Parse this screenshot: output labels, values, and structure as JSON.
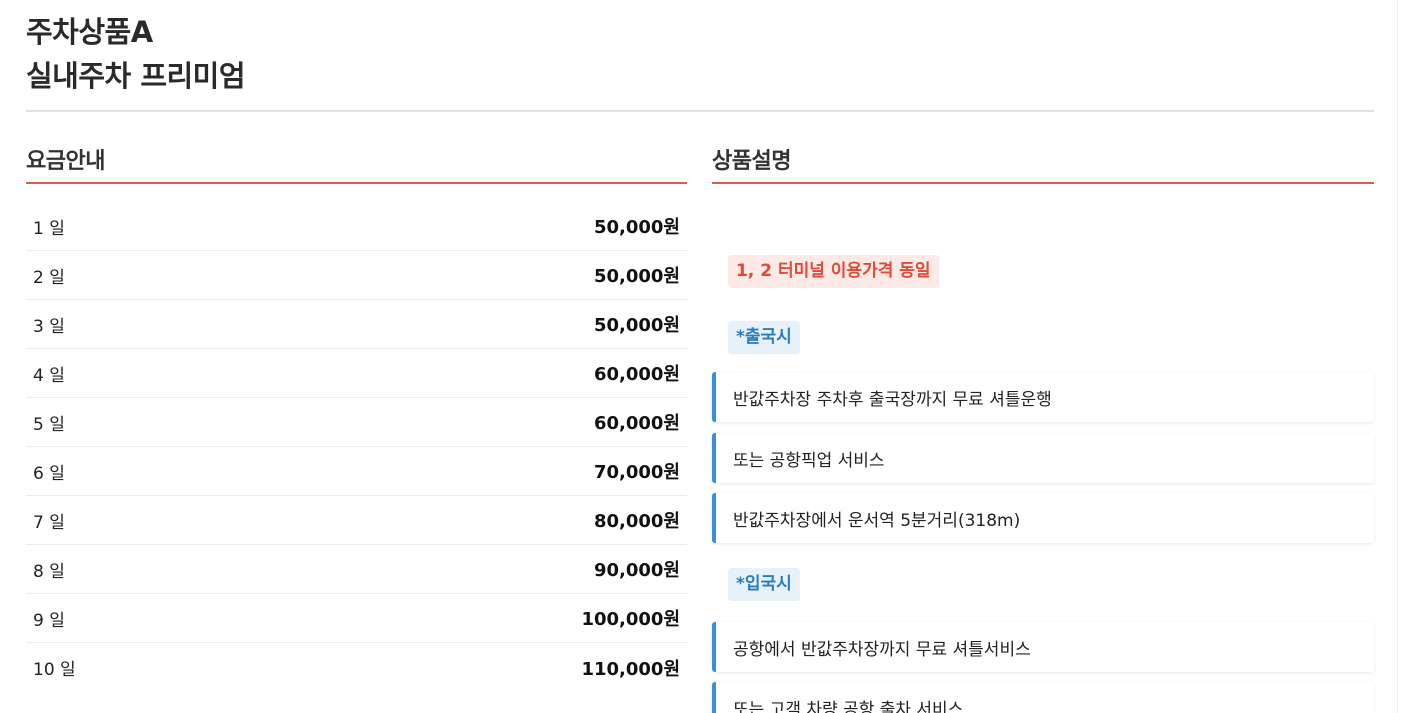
{
  "header": {
    "line1": "주차상품A",
    "line2": "실내주차 프리미엄"
  },
  "pricing": {
    "title": "요금안내",
    "rows": [
      {
        "day": "1 일",
        "price": "50,000원"
      },
      {
        "day": "2 일",
        "price": "50,000원"
      },
      {
        "day": "3 일",
        "price": "50,000원"
      },
      {
        "day": "4 일",
        "price": "60,000원"
      },
      {
        "day": "5 일",
        "price": "60,000원"
      },
      {
        "day": "6 일",
        "price": "70,000원"
      },
      {
        "day": "7 일",
        "price": "80,000원"
      },
      {
        "day": "8 일",
        "price": "90,000원"
      },
      {
        "day": "9 일",
        "price": "100,000원"
      },
      {
        "day": "10 일",
        "price": "110,000원"
      }
    ]
  },
  "description": {
    "title": "상품설명",
    "notice": "1, 2 터미널 이용가격 동일",
    "departure": {
      "label": "*출국시",
      "items": [
        "반값주차장 주차후 출국장까지 무료 셔틀운행",
        "또는 공항픽업 서비스",
        "반값주차장에서 운서역 5분거리(318m)"
      ]
    },
    "arrival": {
      "label": "*입국시",
      "items": [
        "공항에서 반값주차장까지 무료 셔틀서비스",
        "또는 고객 차량 공항 출차 서비스"
      ]
    }
  },
  "colors": {
    "accent_red": "#e05a47",
    "accent_blue": "#3a8fd6",
    "notice_bg": "#fde9e6",
    "tag_bg": "#e7f1fa"
  }
}
